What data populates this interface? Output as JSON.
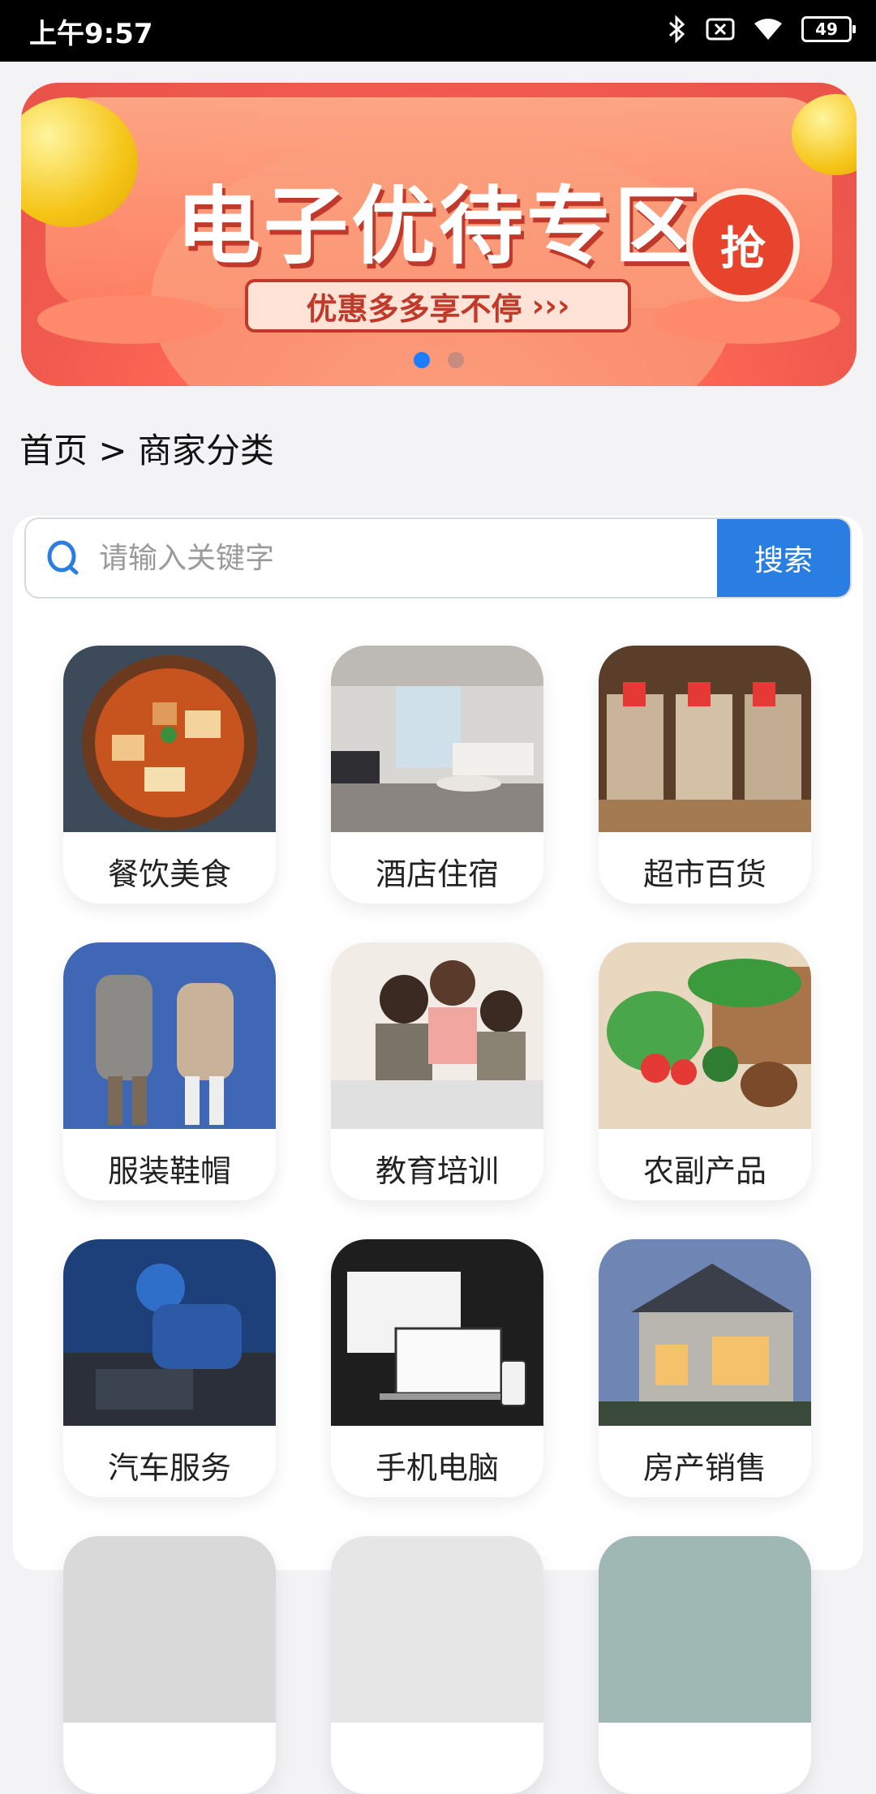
{
  "status_bar": {
    "time": "上午9:57",
    "battery": "49"
  },
  "banner": {
    "title": "电子优待专区",
    "badge": "抢",
    "subtitle": "优惠多多享不停",
    "arrows": "›››"
  },
  "breadcrumb": "首页 > 商家分类",
  "search": {
    "placeholder": "请输入关键字",
    "button": "搜索"
  },
  "categories": [
    {
      "label": "餐饮美食",
      "icon": "food-image"
    },
    {
      "label": "酒店住宿",
      "icon": "hotel-image"
    },
    {
      "label": "超市百货",
      "icon": "supermarket-image"
    },
    {
      "label": "服装鞋帽",
      "icon": "clothing-image"
    },
    {
      "label": "教育培训",
      "icon": "education-image"
    },
    {
      "label": "农副产品",
      "icon": "vegetables-image"
    },
    {
      "label": "汽车服务",
      "icon": "car-service-image"
    },
    {
      "label": "手机电脑",
      "icon": "devices-image"
    },
    {
      "label": "房产销售",
      "icon": "house-image"
    }
  ],
  "colors": {
    "accent": "#2a7de1",
    "dot_active": "#1e7cff"
  }
}
